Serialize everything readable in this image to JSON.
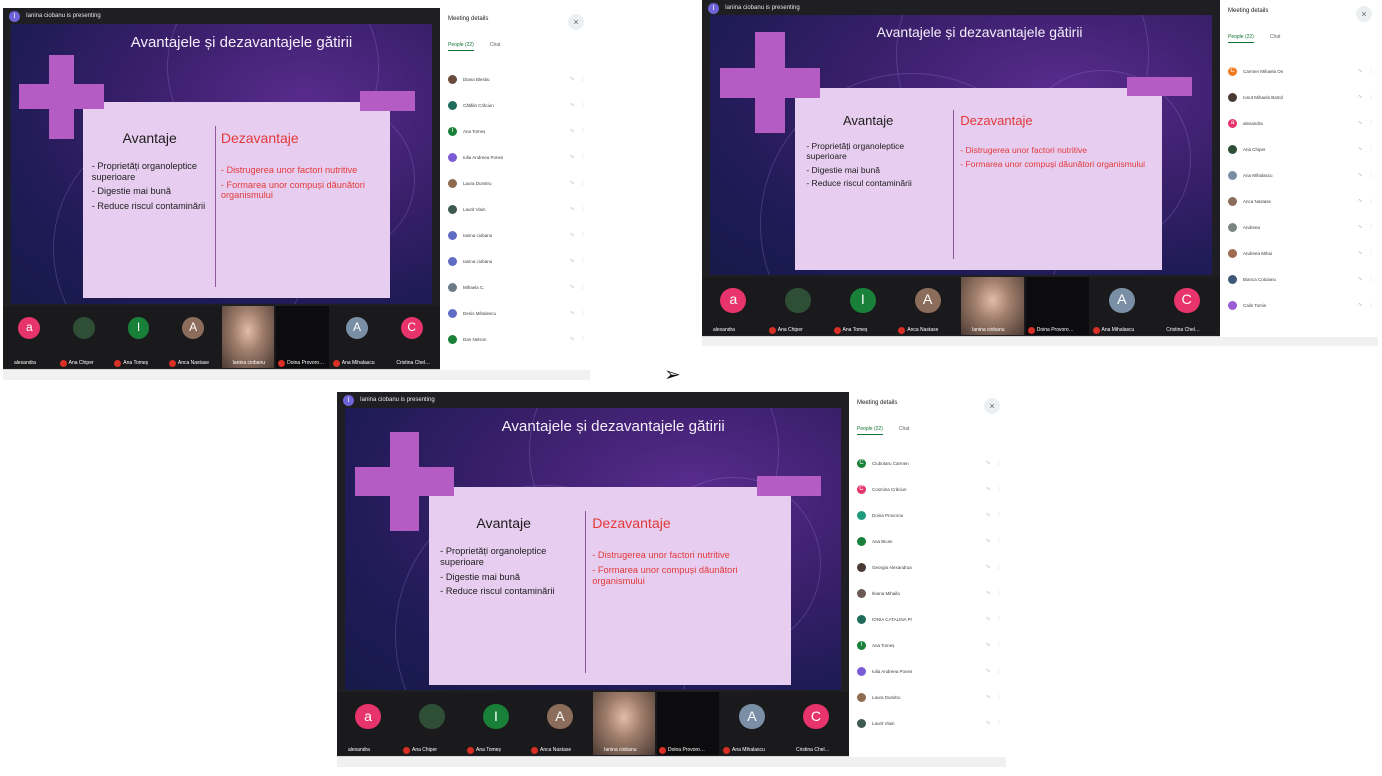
{
  "arrow": "➢",
  "meeting": {
    "presenting_text": "Ianina ciobanu is presenting",
    "side_title": "Meeting details",
    "close_glyph": "×",
    "tab_people": "People (22)",
    "tab_chat": "Chat"
  },
  "slide": {
    "title": "Avantajele și dezavantajele gătirii",
    "advantages_title": "Avantaje",
    "disadvantages_title": "Dezavantaje",
    "advantages": [
      "- Proprietăți organoleptice superioare",
      "- Digestie mai bună",
      "- Reduce riscul contaminării"
    ],
    "disadvantages": [
      "- Distrugerea unor factori nutritive",
      "- Formarea unor compuși dăunători organismului"
    ]
  },
  "strip_tiles": [
    {
      "name": "alexandra",
      "initial": "a",
      "color": "#e8346c",
      "kind": "avatar"
    },
    {
      "name": "Ana Chiper",
      "initial": "",
      "color": "#2e4f36",
      "kind": "photo"
    },
    {
      "name": "Ana Tomeș",
      "initial": "I",
      "color": "#188038",
      "kind": "avatar"
    },
    {
      "name": "Anca Nastase",
      "initial": "A",
      "color": "#8c6d5c",
      "kind": "avatar"
    },
    {
      "name": "Ianina ciobanu",
      "initial": "",
      "color": "",
      "kind": "camera"
    },
    {
      "name": "Doina Provoro…",
      "initial": "",
      "color": "",
      "kind": "dark"
    },
    {
      "name": "Ana Mihalascu",
      "initial": "A",
      "color": "#7a8fa6",
      "kind": "avatar"
    },
    {
      "name": "Cristina Chel…",
      "initial": "C",
      "color": "#e8346c",
      "kind": "avatar"
    }
  ],
  "people_list_1": [
    {
      "name": "Diana Blestiu",
      "initial": "",
      "color": "#6b4b3c"
    },
    {
      "name": "Cătălin Crăciun",
      "initial": "",
      "color": "#1e6b5a"
    },
    {
      "name": "Ana Tomeș",
      "initial": "I",
      "color": "#188038"
    },
    {
      "name": "Iulia Andreea Ponea",
      "initial": "",
      "color": "#7b5cd6"
    },
    {
      "name": "Laura Dumitru",
      "initial": "",
      "color": "#8f6b4f"
    },
    {
      "name": "Laurit Vlain",
      "initial": "",
      "color": "#3d5a4f"
    },
    {
      "name": "Ianina ciobanu",
      "initial": "",
      "color": "#5f6cc4"
    },
    {
      "name": "Ianina ciobanu",
      "initial": "",
      "color": "#5f6cc4"
    },
    {
      "name": "Mihaela C.",
      "initial": "",
      "color": "#6b7c87"
    },
    {
      "name": "Denis Mihalescu",
      "initial": "",
      "color": "#5f6cc4"
    },
    {
      "name": "Dan Nelson",
      "initial": "",
      "color": "#188038"
    }
  ],
  "people_list_2": [
    {
      "name": "Carmen Mihaela Onut",
      "initial": "C",
      "color": "#f07a1e"
    },
    {
      "name": "Ionut Mihaela Bartoloanu",
      "initial": "",
      "color": "#4a3a34"
    },
    {
      "name": "alexandra",
      "initial": "a",
      "color": "#e8346c"
    },
    {
      "name": "Ana Chiper",
      "initial": "",
      "color": "#2e4f36"
    },
    {
      "name": "Ana Mihalascu",
      "initial": "",
      "color": "#7a8fa6"
    },
    {
      "name": "Anca Nastase",
      "initial": "",
      "color": "#8c6d5c"
    },
    {
      "name": "Andreea",
      "initial": "",
      "color": "#7a8583"
    },
    {
      "name": "Andreea Mihai",
      "initial": "",
      "color": "#a06a50"
    },
    {
      "name": "Bianca Cotoianu",
      "initial": "",
      "color": "#3d5876"
    },
    {
      "name": "Calin Tomin",
      "initial": "",
      "color": "#9a5ed4"
    }
  ],
  "people_list_3": [
    {
      "name": "Ciubotaru Carmen",
      "initial": "C",
      "color": "#188038"
    },
    {
      "name": "Cosmina Crăciun",
      "initial": "C",
      "color": "#e8346c"
    },
    {
      "name": "Doina Provorou",
      "initial": "",
      "color": "#1e9b7c"
    },
    {
      "name": "Ana Bican",
      "initial": "",
      "color": "#188038"
    },
    {
      "name": "Georgia Alexandrua",
      "initial": "",
      "color": "#4a3a34"
    },
    {
      "name": "Ileana Mihaila",
      "initial": "",
      "color": "#6b5a52"
    },
    {
      "name": "IONIA CATALINA Prisnal",
      "initial": "",
      "color": "#1e6b5a"
    },
    {
      "name": "Ana Tomeș",
      "initial": "I",
      "color": "#188038"
    },
    {
      "name": "Iulia Andreea Ponea",
      "initial": "",
      "color": "#7b5cd6"
    },
    {
      "name": "Laura Dumitru",
      "initial": "",
      "color": "#8f6b4f"
    },
    {
      "name": "Laurit Vlain",
      "initial": "",
      "color": "#3d5a4f"
    }
  ]
}
